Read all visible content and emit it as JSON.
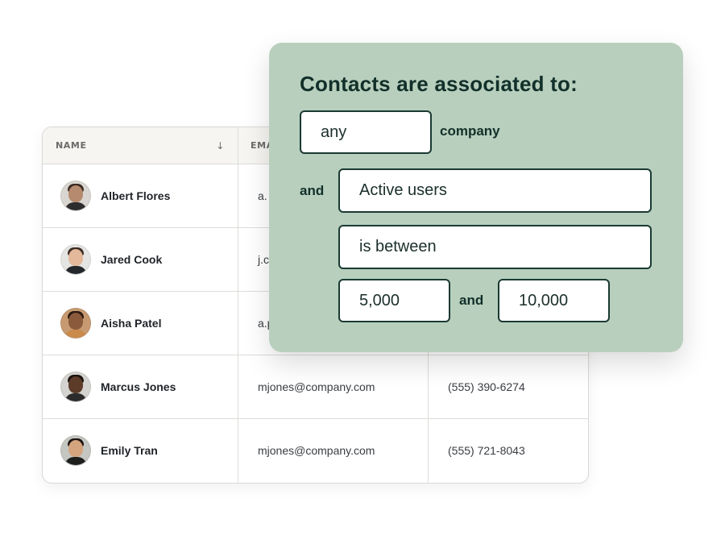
{
  "table": {
    "columns": {
      "name": "NAME",
      "email": "EMA"
    },
    "sort_icon": "↓",
    "rows": [
      {
        "name": "Albert Flores",
        "email": "a.",
        "phone": "",
        "avatar": {
          "skin": "#b58a6e",
          "hair": "#3b2b22",
          "shirt": "#2d2d2d",
          "bg": "#d9d6d1"
        }
      },
      {
        "name": "Jared Cook",
        "email": "j.c",
        "phone": "",
        "avatar": {
          "skin": "#e3b89b",
          "hair": "#3b2b22",
          "shirt": "#23262b",
          "bg": "#e4e4e2"
        }
      },
      {
        "name": "Aisha Patel",
        "email": "a.p",
        "phone": "",
        "avatar": {
          "skin": "#8b5a3c",
          "hair": "#2a1a12",
          "shirt": "#c98a4b",
          "bg": "#c79a72"
        }
      },
      {
        "name": "Marcus Jones",
        "email": "mjones@company.com",
        "phone": "(555) 390-6274",
        "avatar": {
          "skin": "#5c3b28",
          "hair": "#1b120d",
          "shirt": "#2b2b2b",
          "bg": "#d4d3d0"
        }
      },
      {
        "name": "Emily Tran",
        "email": "mjones@company.com",
        "phone": "(555) 721-8043",
        "avatar": {
          "skin": "#d4a47f",
          "hair": "#1c1410",
          "shirt": "#1e1e1e",
          "bg": "#c4c6c1"
        }
      }
    ]
  },
  "filter": {
    "title": "Contacts are associated to:",
    "quantifier_value": "any",
    "entity_label": "company",
    "and_label": "and",
    "property_value": "Active users",
    "operator_value": "is between",
    "min_value": "5,000",
    "between_and_label": "and",
    "max_value": "10,000"
  },
  "colors": {
    "panel_bg": "#b8cfbd",
    "panel_text": "#12302a",
    "box_border": "#1a3a33"
  }
}
